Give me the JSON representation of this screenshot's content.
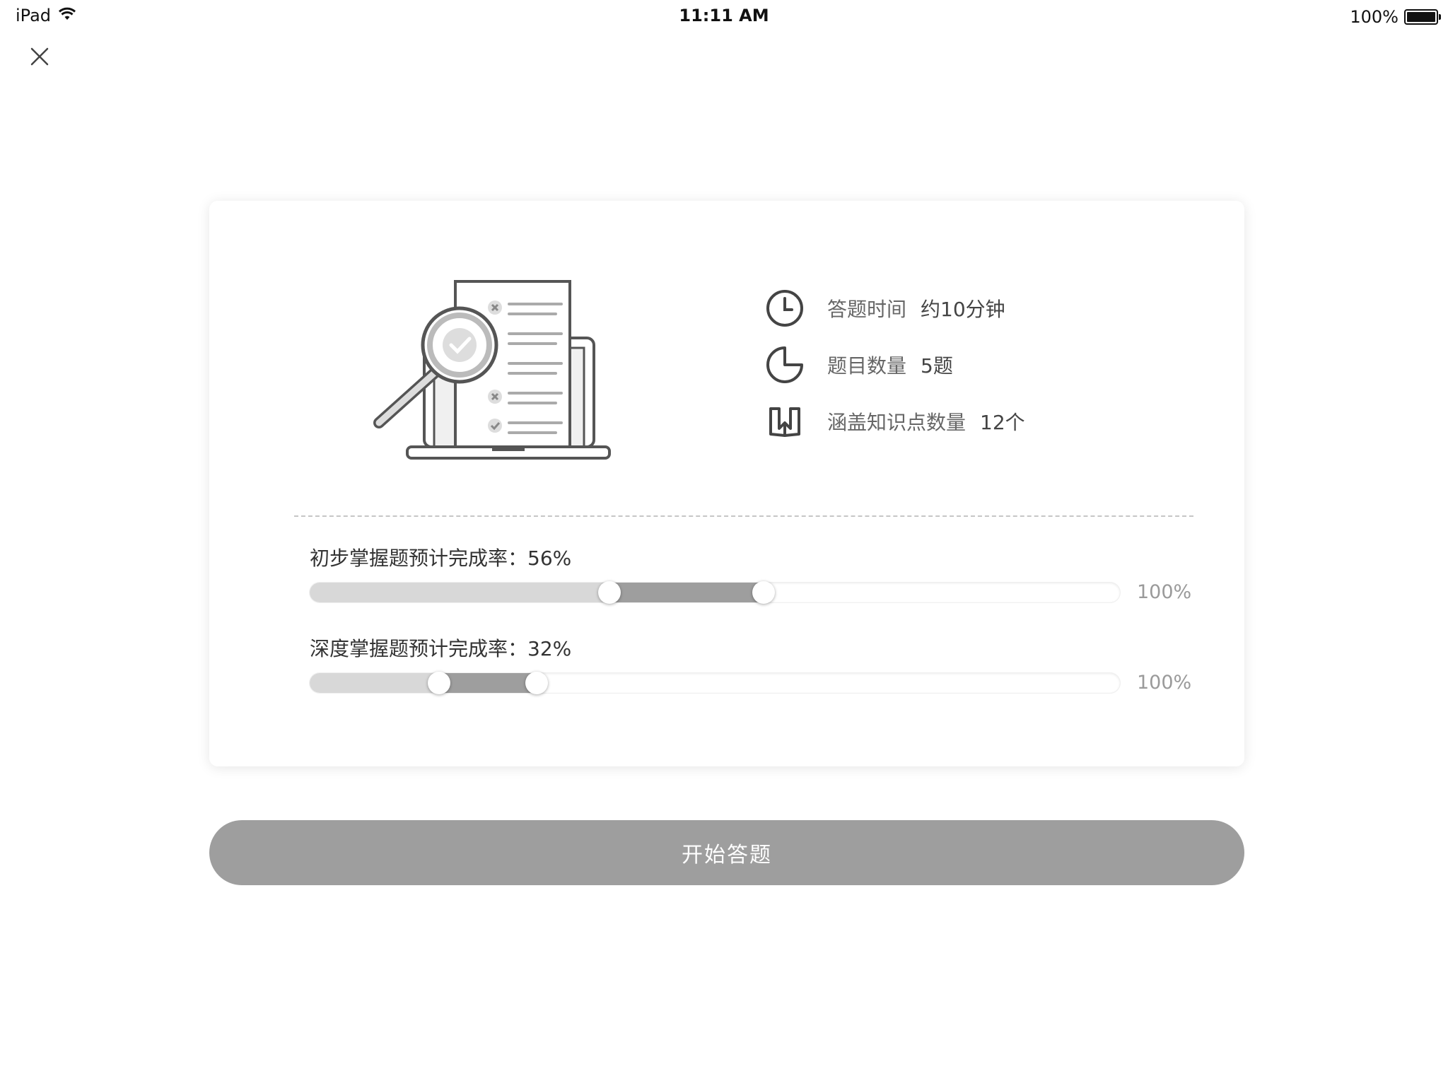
{
  "status_bar": {
    "device": "iPad",
    "time": "11:11 AM",
    "battery": "100%"
  },
  "info": {
    "time_label": "答题时间",
    "time_value": "约10分钟",
    "count_label": "题目数量",
    "count_value": "5题",
    "knowledge_label": "涵盖知识点数量",
    "knowledge_value": "12个"
  },
  "progress": {
    "basic": {
      "title": "初步掌握题预计完成率：56%",
      "range_start": 0.37,
      "range_end": 0.56,
      "max_label": "100%"
    },
    "deep": {
      "title": "深度掌握题预计完成率：32%",
      "range_start": 0.16,
      "range_end": 0.28,
      "max_label": "100%"
    }
  },
  "start_button": "开始答题",
  "icons": {
    "close": "close-icon",
    "time": "clock-icon",
    "count": "pie-chart-icon",
    "knowledge": "book-icon",
    "wifi": "wifi-icon",
    "battery": "battery-icon"
  },
  "colors": {
    "fill_dark": "#9e9e9e",
    "fill_light": "#d8d8d8",
    "button": "#9e9e9e"
  }
}
